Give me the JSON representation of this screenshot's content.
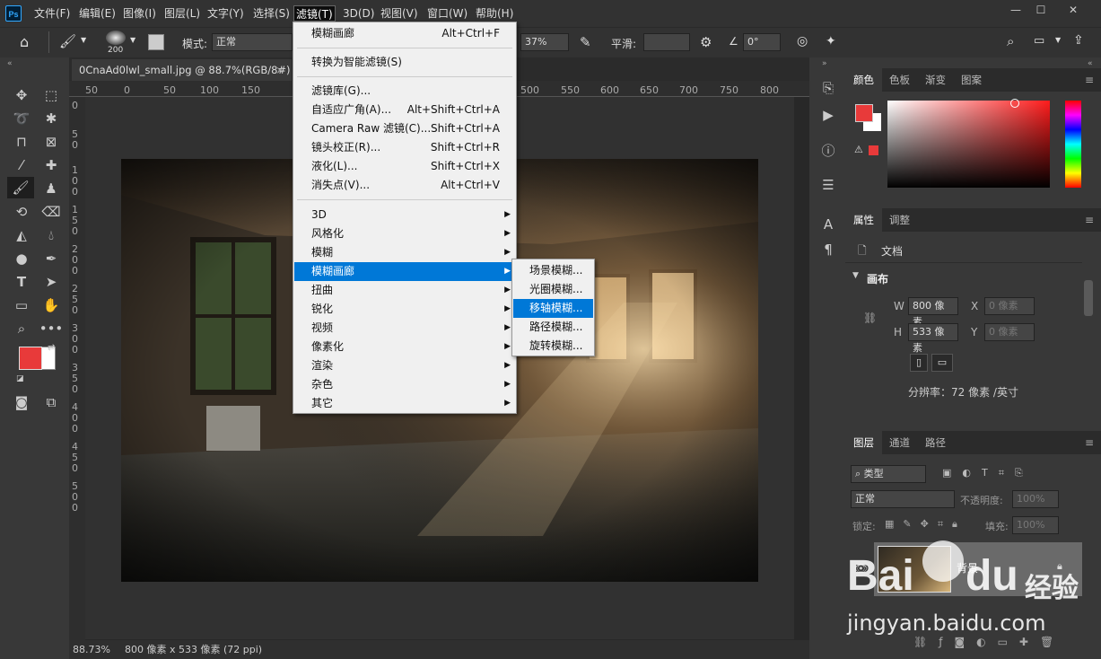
{
  "app": {
    "logo": "Ps"
  },
  "menubar": [
    "文件(F)",
    "编辑(E)",
    "图像(I)",
    "图层(L)",
    "文字(Y)",
    "选择(S)",
    "滤镜(T)",
    "3D(D)",
    "视图(V)",
    "窗口(W)",
    "帮助(H)"
  ],
  "window_controls": {
    "min": "—",
    "max": "☐",
    "close": "✕"
  },
  "options": {
    "brush_size": "200",
    "mode_label": "模式:",
    "mode_value": "正常",
    "opacity_value": "37%",
    "smooth_label": "平滑:",
    "angle_value": "0°"
  },
  "document": {
    "tab_title": "0CnaAd0lwl_small.jpg @ 88.7%(RGB/8#)",
    "tab_close": "×"
  },
  "ruler_h": [
    "50",
    "0",
    "50",
    "100",
    "150",
    "500",
    "550",
    "600",
    "650",
    "700",
    "750",
    "800"
  ],
  "ruler_v": [
    "0",
    "5",
    "0",
    "1",
    "0",
    "0",
    "1",
    "5",
    "0",
    "2",
    "0",
    "0",
    "2",
    "5",
    "0",
    "3",
    "0",
    "0",
    "3",
    "5",
    "0",
    "4",
    "0",
    "0",
    "4",
    "5",
    "0",
    "5",
    "0",
    "0"
  ],
  "status": {
    "zoom": "88.73%",
    "info": "800 像素 x 533 像素 (72 ppi)"
  },
  "filter_menu": {
    "top": [
      {
        "label": "模糊画廊",
        "key": "Alt+Ctrl+F"
      },
      {
        "label": "转换为智能滤镜(S)",
        "key": ""
      }
    ],
    "mid": [
      {
        "label": "滤镜库(G)...",
        "key": ""
      },
      {
        "label": "自适应广角(A)...",
        "key": "Alt+Shift+Ctrl+A"
      },
      {
        "label": "Camera Raw 滤镜(C)...",
        "key": "Shift+Ctrl+A"
      },
      {
        "label": "镜头校正(R)...",
        "key": "Shift+Ctrl+R"
      },
      {
        "label": "液化(L)...",
        "key": "Shift+Ctrl+X"
      },
      {
        "label": "消失点(V)...",
        "key": "Alt+Ctrl+V"
      }
    ],
    "sub": [
      "3D",
      "风格化",
      "模糊",
      "模糊画廊",
      "扭曲",
      "锐化",
      "视频",
      "像素化",
      "渲染",
      "杂色",
      "其它"
    ],
    "highlighted": "模糊画廊"
  },
  "blur_gallery_menu": [
    "场景模糊...",
    "光圈模糊...",
    "移轴模糊...",
    "路径模糊...",
    "旋转模糊..."
  ],
  "blur_gallery_highlighted": "移轴模糊...",
  "color_panel": {
    "tabs": [
      "颜色",
      "色板",
      "渐变",
      "图案"
    ],
    "fg": "#e83a3a",
    "bg": "#ffffff"
  },
  "props_panel": {
    "tabs": [
      "属性",
      "调整"
    ],
    "doc_label": "文档",
    "section": "画布",
    "w_label": "W",
    "w_value": "800 像素",
    "h_label": "H",
    "h_value": "533 像素",
    "x_label": "X",
    "x_value": "0 像素",
    "y_label": "Y",
    "y_value": "0 像素",
    "resolution": "分辨率：72 像素 /英寸"
  },
  "layers_panel": {
    "tabs": [
      "图层",
      "通道",
      "路径"
    ],
    "filter_kind": "类型",
    "blend": "正常",
    "opacity_label": "不透明度:",
    "opacity": "100%",
    "lock_label": "锁定:",
    "fill_label": "填充:",
    "fill": "100%",
    "layer_name": "背景"
  },
  "watermark": {
    "line1": "Bai",
    "line2": "du",
    "line3": "经验",
    "url": "jingyan.baidu.com"
  }
}
